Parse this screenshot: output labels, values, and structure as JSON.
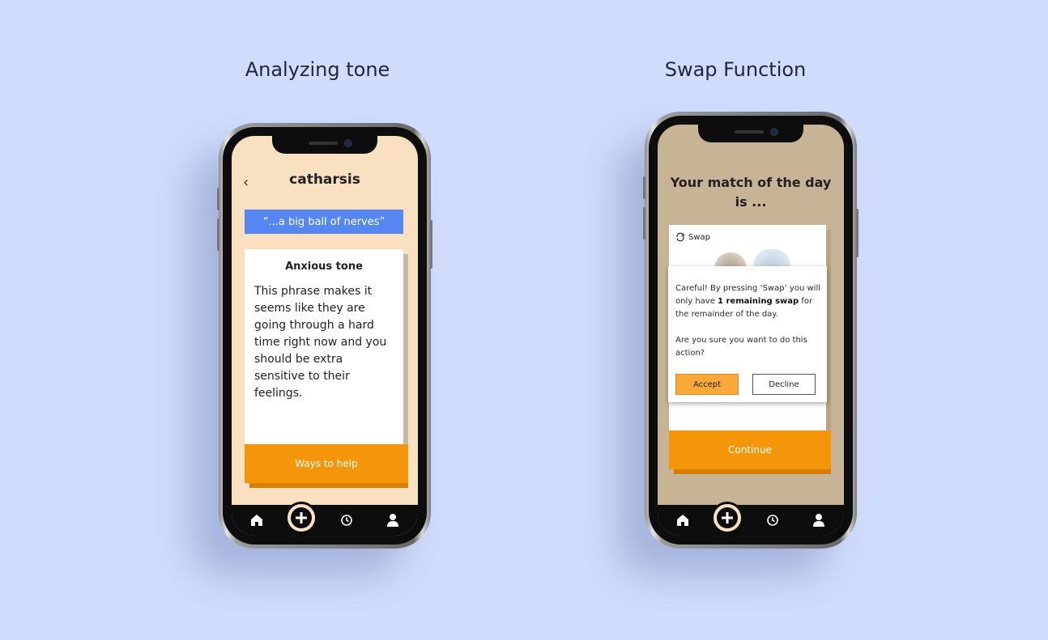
{
  "left_panel": {
    "heading": "Analyzing tone",
    "app_title": "catharsis",
    "back_glyph": "‹",
    "quote": "“...a big ball of nerves”",
    "card_title": "Anxious tone",
    "card_body": "This phrase makes it seems like they are going through a hard time right now and you should be extra sensitive to their feelings.",
    "cta_label": "Ways to help"
  },
  "right_panel": {
    "heading": "Swap Function",
    "match_title": "Your match of the day is ...",
    "swap_label": "Swap",
    "dialog": {
      "text_before": "Careful! By pressing ‘Swap’ you will only have ",
      "text_bold": "1 remaining swap",
      "text_after": " for the remainder of the day.",
      "question": "Are you sure you want to do this action?",
      "accept_label": "Accept",
      "decline_label": "Decline"
    },
    "cta_label": "Continue"
  },
  "nav_icons": [
    "home-icon",
    "add-icon",
    "history-icon",
    "profile-icon"
  ],
  "colors": {
    "background": "#d0dcfc",
    "left_screen": "#f8e0c0",
    "right_screen": "#c7b496",
    "accent_orange": "#f5960a",
    "accent_blue": "#5686f1",
    "accept_button": "#f8a93a"
  }
}
